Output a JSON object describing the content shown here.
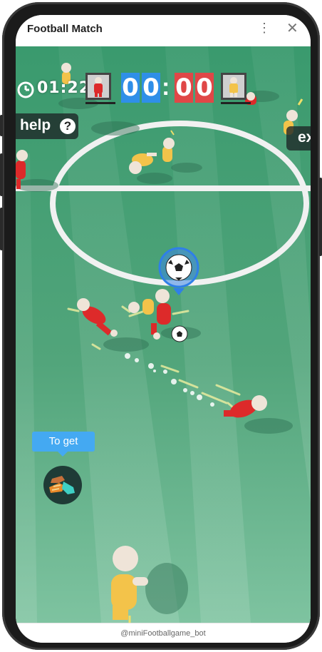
{
  "window": {
    "title": "Football Match",
    "menu_icon": "more-vertical-icon",
    "close_icon": "close-icon"
  },
  "hud": {
    "clock_icon": "clock-icon",
    "time": "01:22",
    "home_score_digits": [
      "0",
      "0"
    ],
    "away_score_digits": [
      "0",
      "0"
    ],
    "score_separator": ":",
    "home_colors": {
      "digit_bg": "#2f8fe8",
      "kit": "#e02a2a"
    },
    "away_colors": {
      "digit_bg": "#e04747",
      "kit": "#f2c530"
    }
  },
  "controls": {
    "help_label": "help",
    "help_icon_glyph": "?",
    "exit_label": "ex"
  },
  "powerup": {
    "label": "To get",
    "icon": "boots-powerup-icon"
  },
  "footer": {
    "text": "@miniFootballgame_bot"
  },
  "colors": {
    "pitch": "#4ea37a",
    "lines": "#f0f0f0",
    "ball_marker": "#2f7fe8"
  }
}
